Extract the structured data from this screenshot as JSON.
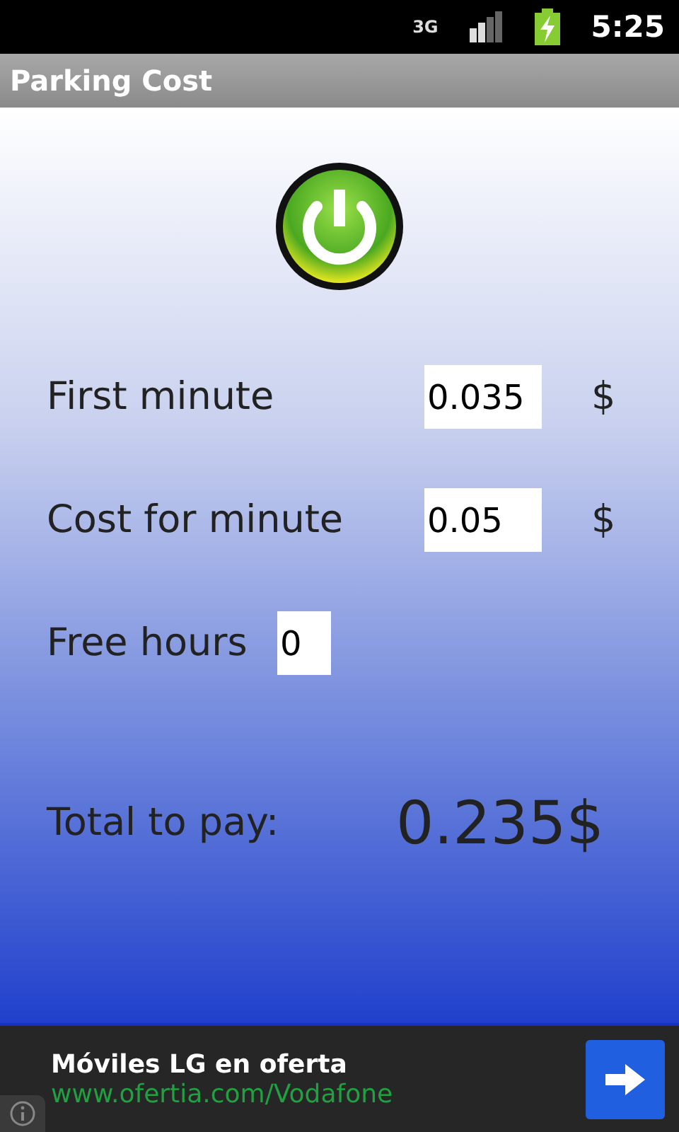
{
  "status_bar": {
    "network": "3G",
    "time": "5:25"
  },
  "title_bar": {
    "title": "Parking Cost"
  },
  "fields": [
    {
      "label": "First minute",
      "value": "0.035",
      "unit": "$"
    },
    {
      "label": "Cost for minute",
      "value": "0.05",
      "unit": "$"
    },
    {
      "label": "Free hours",
      "value": "0"
    }
  ],
  "total": {
    "label": "Total to pay:",
    "value": "0.235$"
  },
  "ad": {
    "headline": "Móviles LG en oferta",
    "url": "www.ofertia.com/Vodafone"
  }
}
